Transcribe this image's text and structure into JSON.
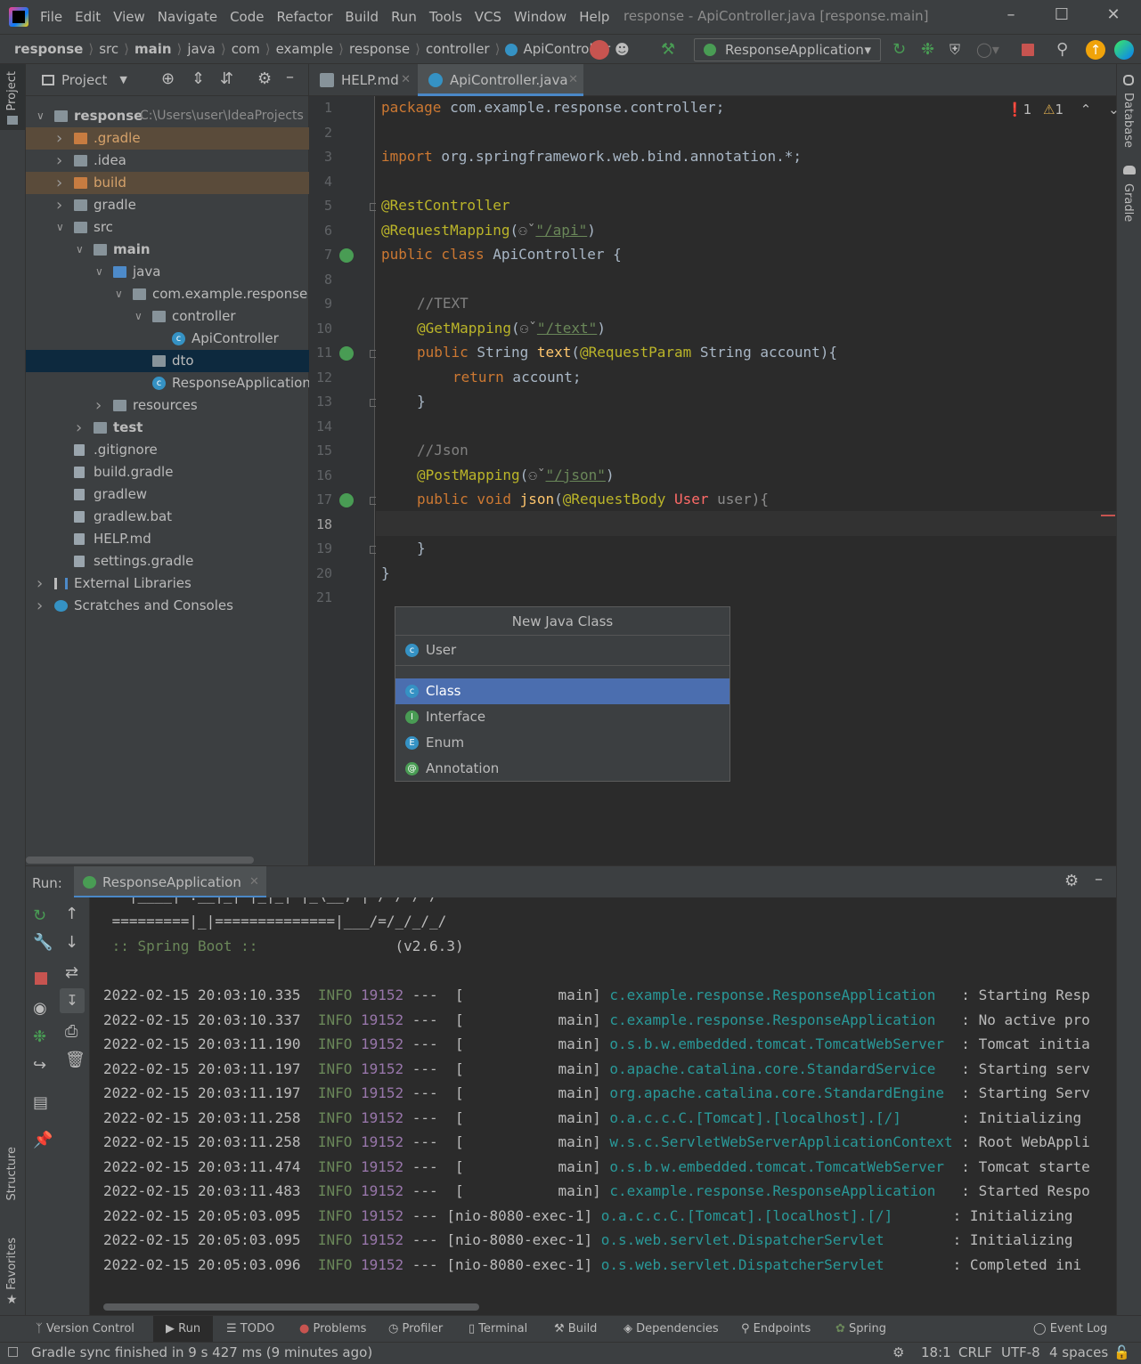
{
  "app": {
    "window_title": "response - ApiController.java [response.main]",
    "menu": [
      "File",
      "Edit",
      "View",
      "Navigate",
      "Code",
      "Refactor",
      "Build",
      "Run",
      "Tools",
      "VCS",
      "Window",
      "Help"
    ]
  },
  "breadcrumbs": [
    "response",
    "src",
    "main",
    "java",
    "com",
    "example",
    "response",
    "controller",
    "ApiController"
  ],
  "run_config": "ResponseApplication",
  "side_tabs": {
    "project": "Project",
    "database": "Database",
    "gradle": "Gradle",
    "structure": "Structure",
    "favorites": "Favorites"
  },
  "project_panel": {
    "title": "Project",
    "tree": [
      {
        "label": "response",
        "hint": "C:\\Users\\user\\IdeaProjects",
        "level": 0,
        "arrow": "v",
        "icon": "folder"
      },
      {
        "label": ".gradle",
        "level": 1,
        "arrow": ">",
        "icon": "folder-orange"
      },
      {
        "label": ".idea",
        "level": 1,
        "arrow": ">",
        "icon": "folder"
      },
      {
        "label": "build",
        "level": 1,
        "arrow": ">",
        "icon": "folder-orange"
      },
      {
        "label": "gradle",
        "level": 1,
        "arrow": ">",
        "icon": "folder"
      },
      {
        "label": "src",
        "level": 1,
        "arrow": "v",
        "icon": "folder"
      },
      {
        "label": "main",
        "level": 2,
        "arrow": "v",
        "icon": "folder"
      },
      {
        "label": "java",
        "level": 3,
        "arrow": "v",
        "icon": "folder-blue"
      },
      {
        "label": "com.example.response",
        "level": 4,
        "arrow": "v",
        "icon": "folder"
      },
      {
        "label": "controller",
        "level": 5,
        "arrow": "v",
        "icon": "folder"
      },
      {
        "label": "ApiController",
        "level": 6,
        "arrow": "",
        "icon": "class"
      },
      {
        "label": "dto",
        "level": 5,
        "arrow": "",
        "icon": "folder"
      },
      {
        "label": "ResponseApplication",
        "level": 5,
        "arrow": "",
        "icon": "class"
      },
      {
        "label": "resources",
        "level": 3,
        "arrow": ">",
        "icon": "folder"
      },
      {
        "label": "test",
        "level": 2,
        "arrow": ">",
        "icon": "folder"
      },
      {
        "label": ".gitignore",
        "level": 1,
        "arrow": "",
        "icon": "file"
      },
      {
        "label": "build.gradle",
        "level": 1,
        "arrow": "",
        "icon": "file"
      },
      {
        "label": "gradlew",
        "level": 1,
        "arrow": "",
        "icon": "file"
      },
      {
        "label": "gradlew.bat",
        "level": 1,
        "arrow": "",
        "icon": "file"
      },
      {
        "label": "HELP.md",
        "level": 1,
        "arrow": "",
        "icon": "file"
      },
      {
        "label": "settings.gradle",
        "level": 1,
        "arrow": "",
        "icon": "file"
      },
      {
        "label": "External Libraries",
        "level": 0,
        "arrow": ">",
        "icon": "lib"
      },
      {
        "label": "Scratches and Consoles",
        "level": 0,
        "arrow": ">",
        "icon": "scratch"
      }
    ]
  },
  "editor": {
    "tabs": [
      {
        "label": "HELP.md",
        "active": false
      },
      {
        "label": "ApiController.java",
        "active": true
      }
    ],
    "inspections": {
      "errors": "1",
      "warnings": "1"
    },
    "line_numbers": [
      "1",
      "2",
      "3",
      "4",
      "5",
      "6",
      "7",
      "8",
      "9",
      "10",
      "11",
      "12",
      "13",
      "14",
      "15",
      "16",
      "17",
      "18",
      "19",
      "20",
      "21"
    ],
    "code": {
      "l1_kw": "package",
      "l1_rest": " com.example.response.controller;",
      "l3_kw": "import",
      "l3_rest": " org.springframework.web.bind.annotation.*;",
      "l5": "@RestController",
      "l6_ann": "@RequestMapping",
      "l6_str": "\"/api\"",
      "l7_kw": "public class",
      "l7_rest": " ApiController {",
      "l9": "//TEXT",
      "l10_ann": "@GetMapping",
      "l10_str": "\"/text\"",
      "l11_kw": "public",
      "l11_type": " String ",
      "l11_fn": "text",
      "l11_ann": "@RequestParam",
      "l11_rest": " String account){",
      "l12_kw": "return",
      "l12_rest": " account;",
      "l13": "}",
      "l15": "//Json",
      "l16_ann": "@PostMapping",
      "l16_str": "\"/json\"",
      "l17_kw": "public void ",
      "l17_fn": "json",
      "l17_ann": "@RequestBody",
      "l17_err": "User",
      "l17_rest": " user){",
      "l19": "}",
      "l20": "}"
    }
  },
  "popup": {
    "title": "New Java Class",
    "input_value": "User",
    "options": [
      "Class",
      "Interface",
      "Enum",
      "Annotation"
    ],
    "selected": "Class"
  },
  "run_panel": {
    "label": "Run:",
    "tab": "ResponseApplication",
    "banner1": " =========|_|==============|___/=/_/_/_/",
    "banner2_label": " :: Spring Boot ::",
    "banner2_ver": "(v2.6.3)",
    "logs": [
      {
        "ts": "2022-02-15 20:03:10.335",
        "lvl": "INFO",
        "pid": "19152",
        "thread": "---  [           main]",
        "logger": "c.example.response.ResponseApplication  ",
        "msg": " : Starting Resp"
      },
      {
        "ts": "2022-02-15 20:03:10.337",
        "lvl": "INFO",
        "pid": "19152",
        "thread": "---  [           main]",
        "logger": "c.example.response.ResponseApplication  ",
        "msg": " : No active pro"
      },
      {
        "ts": "2022-02-15 20:03:11.190",
        "lvl": "INFO",
        "pid": "19152",
        "thread": "---  [           main]",
        "logger": "o.s.b.w.embedded.tomcat.TomcatWebServer ",
        "msg": " : Tomcat initia"
      },
      {
        "ts": "2022-02-15 20:03:11.197",
        "lvl": "INFO",
        "pid": "19152",
        "thread": "---  [           main]",
        "logger": "o.apache.catalina.core.StandardService  ",
        "msg": " : Starting serv"
      },
      {
        "ts": "2022-02-15 20:03:11.197",
        "lvl": "INFO",
        "pid": "19152",
        "thread": "---  [           main]",
        "logger": "org.apache.catalina.core.StandardEngine ",
        "msg": " : Starting Serv"
      },
      {
        "ts": "2022-02-15 20:03:11.258",
        "lvl": "INFO",
        "pid": "19152",
        "thread": "---  [           main]",
        "logger": "o.a.c.c.C.[Tomcat].[localhost].[/]      ",
        "msg": " : Initializing "
      },
      {
        "ts": "2022-02-15 20:03:11.258",
        "lvl": "INFO",
        "pid": "19152",
        "thread": "---  [           main]",
        "logger": "w.s.c.ServletWebServerApplicationContext",
        "msg": " : Root WebAppli"
      },
      {
        "ts": "2022-02-15 20:03:11.474",
        "lvl": "INFO",
        "pid": "19152",
        "thread": "---  [           main]",
        "logger": "o.s.b.w.embedded.tomcat.TomcatWebServer ",
        "msg": " : Tomcat starte"
      },
      {
        "ts": "2022-02-15 20:03:11.483",
        "lvl": "INFO",
        "pid": "19152",
        "thread": "---  [           main]",
        "logger": "c.example.response.ResponseApplication  ",
        "msg": " : Started Respo"
      },
      {
        "ts": "2022-02-15 20:05:03.095",
        "lvl": "INFO",
        "pid": "19152",
        "thread": "--- [nio-8080-exec-1]",
        "logger": "o.a.c.c.C.[Tomcat].[localhost].[/]      ",
        "msg": " : Initializing "
      },
      {
        "ts": "2022-02-15 20:05:03.095",
        "lvl": "INFO",
        "pid": "19152",
        "thread": "--- [nio-8080-exec-1]",
        "logger": "o.s.web.servlet.DispatcherServlet       ",
        "msg": " : Initializing "
      },
      {
        "ts": "2022-02-15 20:05:03.096",
        "lvl": "INFO",
        "pid": "19152",
        "thread": "--- [nio-8080-exec-1]",
        "logger": "o.s.web.servlet.DispatcherServlet       ",
        "msg": " : Completed ini"
      }
    ]
  },
  "bottom_tabs": [
    "Version Control",
    "Run",
    "TODO",
    "Problems",
    "Profiler",
    "Terminal",
    "Build",
    "Dependencies",
    "Endpoints",
    "Spring",
    "Event Log"
  ],
  "status": {
    "message": "Gradle sync finished in 9 s 427 ms (9 minutes ago)",
    "position": "18:1",
    "line_sep": "CRLF",
    "encoding": "UTF-8",
    "indent": "4 spaces"
  }
}
